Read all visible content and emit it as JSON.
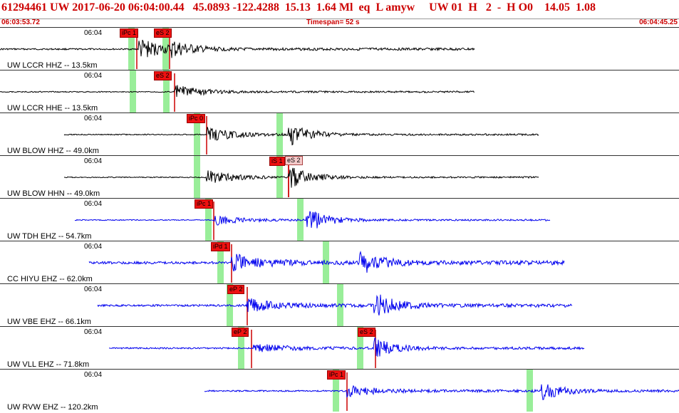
{
  "header": {
    "event_line": "61294461 UW 2017-06-20 06:04:00.44   45.0893 -122.4288  15.13  1.64 Ml  eq  L amyw     UW 01  H   2  -  H O0    14.05  1.08",
    "start_time": "06:03:53.72",
    "timespan": "Timespan=  52 s",
    "end_time": "06:04:45.25"
  },
  "colors": {
    "event_text": "#cc0000",
    "velocity_trace": "#000000",
    "short_period_trace": "#0000ee",
    "pick_fill": "#ee1111",
    "pick_fill_secondary": "#f4c9c9",
    "pick_line": "#cc0000",
    "window_marker": "#99ee99"
  },
  "panels": [
    {
      "channel": "UW LCCR HHZ -- 13.5km",
      "time_label": "06:04",
      "trace_color": "black",
      "picks": [
        {
          "label": "iPc 1",
          "style": "solid"
        },
        {
          "label": "eS 2",
          "style": "solid"
        }
      ]
    },
    {
      "channel": "UW LCCR HHE -- 13.5km",
      "time_label": "06:04",
      "trace_color": "black",
      "picks": [
        {
          "label": "eS 2",
          "style": "solid"
        }
      ]
    },
    {
      "channel": "UW BLOW HHZ -- 49.0km",
      "time_label": "06:04",
      "trace_color": "black",
      "picks": [
        {
          "label": "iPc 0",
          "style": "solid"
        }
      ]
    },
    {
      "channel": "UW BLOW HHN -- 49.0km",
      "time_label": "06:04",
      "trace_color": "black",
      "picks": [
        {
          "label": "iS 1",
          "style": "solid"
        },
        {
          "label": "eS 2",
          "style": "light"
        }
      ]
    },
    {
      "channel": "UW TDH EHZ -- 54.7km",
      "time_label": "06:04",
      "trace_color": "blue",
      "picks": [
        {
          "label": "iPc 1",
          "style": "solid"
        }
      ]
    },
    {
      "channel": "CC HIYU EHZ -- 62.0km",
      "time_label": "06:04",
      "trace_color": "blue",
      "picks": [
        {
          "label": "iPd 1",
          "style": "solid"
        }
      ]
    },
    {
      "channel": "UW VBE EHZ -- 66.1km",
      "time_label": "06:04",
      "trace_color": "blue",
      "picks": [
        {
          "label": "eP 2",
          "style": "solid"
        }
      ]
    },
    {
      "channel": "UW VLL EHZ -- 71.8km",
      "time_label": "06:04",
      "trace_color": "blue",
      "picks": [
        {
          "label": "eP 2",
          "style": "solid"
        },
        {
          "label": "eS 2",
          "style": "solid"
        }
      ]
    },
    {
      "channel": "UW RVW EHZ -- 120.2km",
      "time_label": "06:04",
      "trace_color": "blue",
      "picks": [
        {
          "label": "iPc 1",
          "style": "solid"
        }
      ]
    }
  ]
}
